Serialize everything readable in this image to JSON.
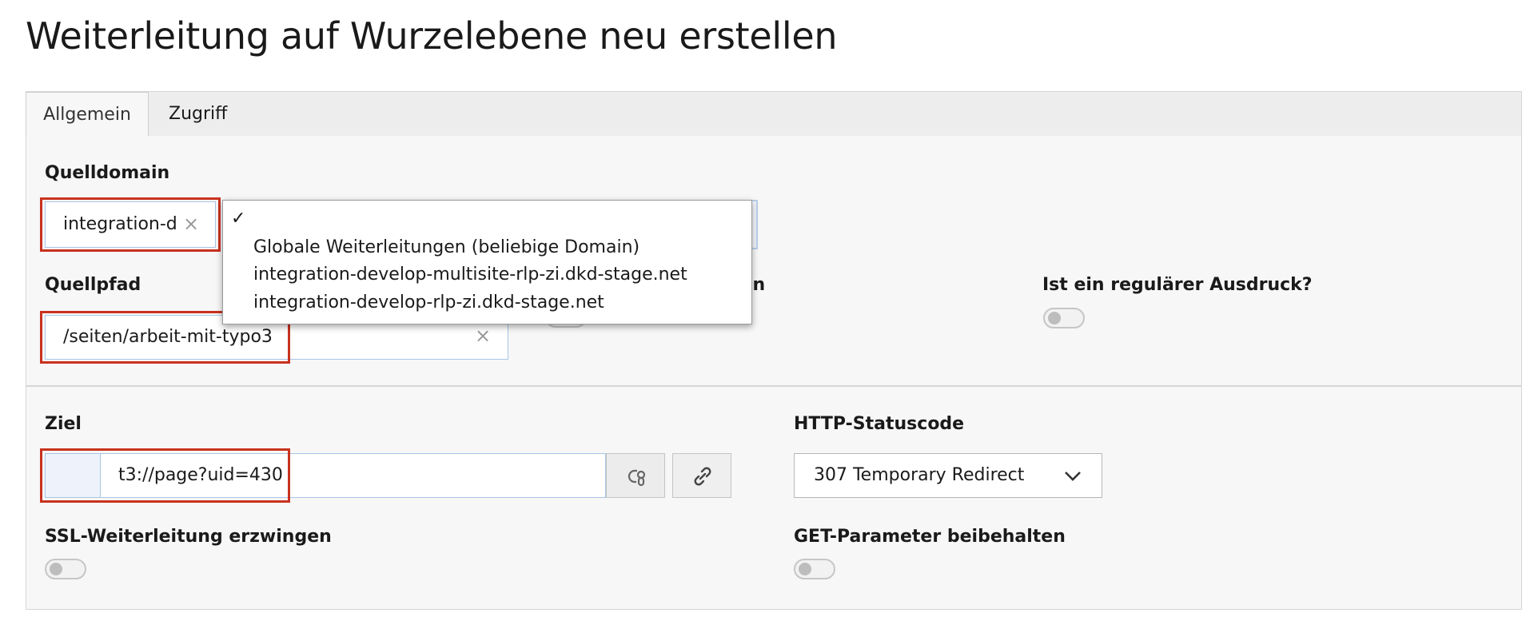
{
  "page": {
    "title": "Weiterleitung auf Wurzelebene neu erstellen"
  },
  "tabs": [
    {
      "label": "Allgemein",
      "active": true
    },
    {
      "label": "Zugriff",
      "active": false
    }
  ],
  "fields": {
    "source_domain": {
      "label": "Quelldomain",
      "value": "integration-d"
    },
    "source_path": {
      "label": "Quellpfad",
      "value": "/seiten/arbeit-mit-typo3"
    },
    "hidden_toggle_label_fragment": "ten",
    "regex": {
      "label": "Ist ein regulärer Ausdruck?"
    },
    "target": {
      "label": "Ziel",
      "value": "t3://page?uid=430"
    },
    "http_status": {
      "label": "HTTP-Statuscode",
      "value": "307 Temporary Redirect"
    },
    "force_ssl": {
      "label": "SSL-Weiterleitung erzwingen"
    },
    "keep_get": {
      "label": "GET-Parameter beibehalten"
    }
  },
  "domain_dropdown": {
    "check": "✓",
    "options": [
      "Globale Weiterleitungen (beliebige Domain)",
      "integration-develop-multisite-rlp-zi.dkd-stage.net",
      "integration-develop-rlp-zi.dkd-stage.net"
    ]
  },
  "icons": {
    "clear": "×",
    "chevron": "chevron-down-icon",
    "link": "link-icon",
    "browse": "link-browser-icon"
  },
  "colors": {
    "highlight": "#c8321f",
    "input_border": "#a8c5e6"
  }
}
